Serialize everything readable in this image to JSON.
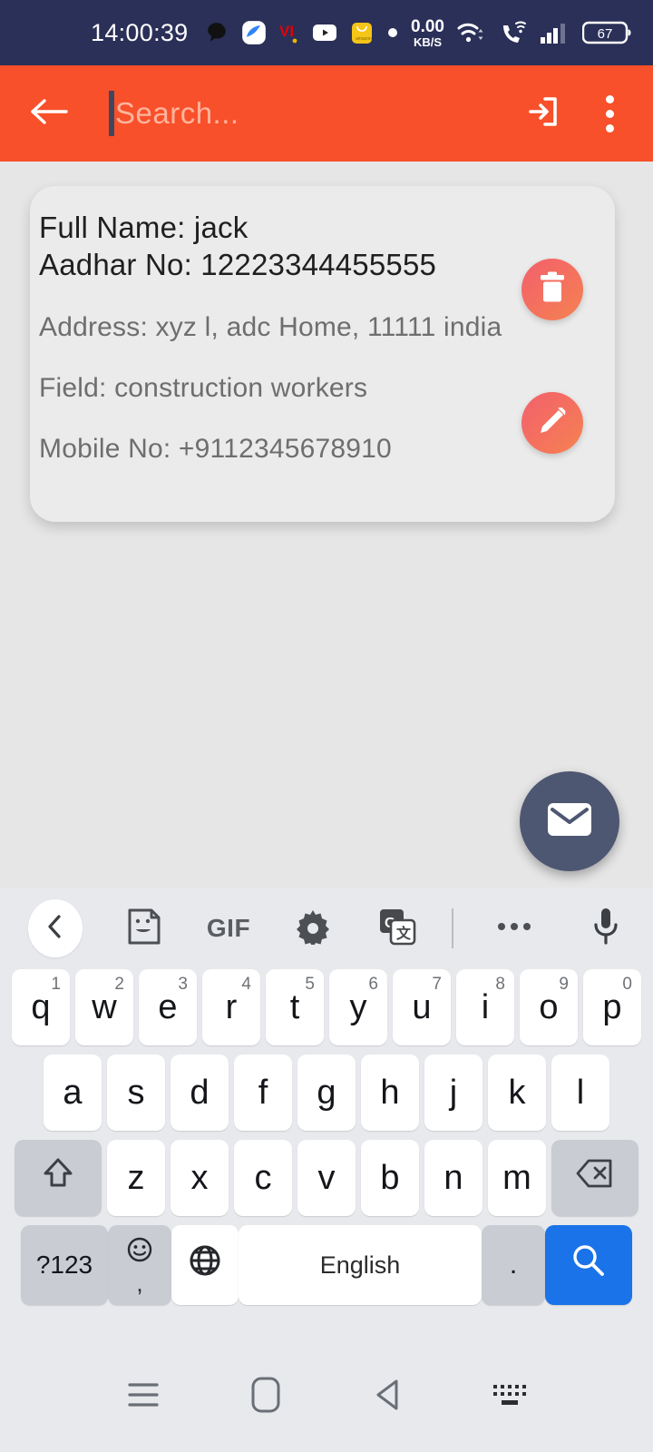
{
  "status_bar": {
    "clock": "14:00:39",
    "network_speed_value": "0.00",
    "network_speed_unit": "KB/S",
    "battery_level": "67",
    "notification_icons": [
      "speech-bubble-icon",
      "blue-app-icon",
      "vi-logo-icon",
      "youtube-icon",
      "shopping-bag-icon",
      "dot-icon"
    ],
    "right_icons": [
      "wifi-icon",
      "vowifi-call-icon",
      "signal-bars-icon",
      "battery-icon"
    ],
    "background": "#2b3058"
  },
  "app_bar": {
    "background": "#f8502a",
    "back_label": "back-arrow",
    "search_placeholder": "Search...",
    "search_value": "",
    "login_label": "login-icon",
    "overflow_label": "more-options"
  },
  "card": {
    "full_name_line": "Full Name: jack",
    "aadhar_line": "Aadhar No: 12223344455555",
    "address_line": "Address: xyz l, adc Home, 11111 india",
    "field_line": "Field: construction workers",
    "mobile_line": "Mobile No: +9112345678910",
    "delete_label": "Delete",
    "edit_label": "Edit",
    "accent_start": "#f2606c",
    "accent_end": "#f58350",
    "background": "#ebebeb"
  },
  "fab": {
    "label": "Mail",
    "color": "#4d5771"
  },
  "keyboard": {
    "toolbar": [
      "back-chevron-icon",
      "sticker-icon",
      "GIF",
      "settings-gear-icon",
      "google-translate-icon",
      "more-dots-icon",
      "microphone-icon"
    ],
    "gif_label": "GIF",
    "rows": [
      [
        {
          "k": "q",
          "h": "1"
        },
        {
          "k": "w",
          "h": "2"
        },
        {
          "k": "e",
          "h": "3"
        },
        {
          "k": "r",
          "h": "4"
        },
        {
          "k": "t",
          "h": "5"
        },
        {
          "k": "y",
          "h": "6"
        },
        {
          "k": "u",
          "h": "7"
        },
        {
          "k": "i",
          "h": "8"
        },
        {
          "k": "o",
          "h": "9"
        },
        {
          "k": "p",
          "h": "0"
        }
      ],
      [
        {
          "k": "a",
          "h": ""
        },
        {
          "k": "s",
          "h": ""
        },
        {
          "k": "d",
          "h": ""
        },
        {
          "k": "f",
          "h": ""
        },
        {
          "k": "g",
          "h": ""
        },
        {
          "k": "h",
          "h": ""
        },
        {
          "k": "j",
          "h": ""
        },
        {
          "k": "k",
          "h": ""
        },
        {
          "k": "l",
          "h": ""
        }
      ],
      [
        {
          "k": "z",
          "h": ""
        },
        {
          "k": "x",
          "h": ""
        },
        {
          "k": "c",
          "h": ""
        },
        {
          "k": "v",
          "h": ""
        },
        {
          "k": "b",
          "h": ""
        },
        {
          "k": "n",
          "h": ""
        },
        {
          "k": "m",
          "h": ""
        }
      ]
    ],
    "shift_label": "shift-icon",
    "backspace_label": "backspace-icon",
    "numeric_label": "?123",
    "emoji_comma_label": ",",
    "globe_label": "language-globe-icon",
    "space_label": "English",
    "period_label": ".",
    "enter_label": "search-icon",
    "enter_color": "#1a73e8"
  },
  "nav_bar": {
    "recents_label": "recents-icon",
    "home_label": "home-icon",
    "back_label": "back-icon",
    "hide_keyboard_label": "hide-keyboard-icon"
  }
}
